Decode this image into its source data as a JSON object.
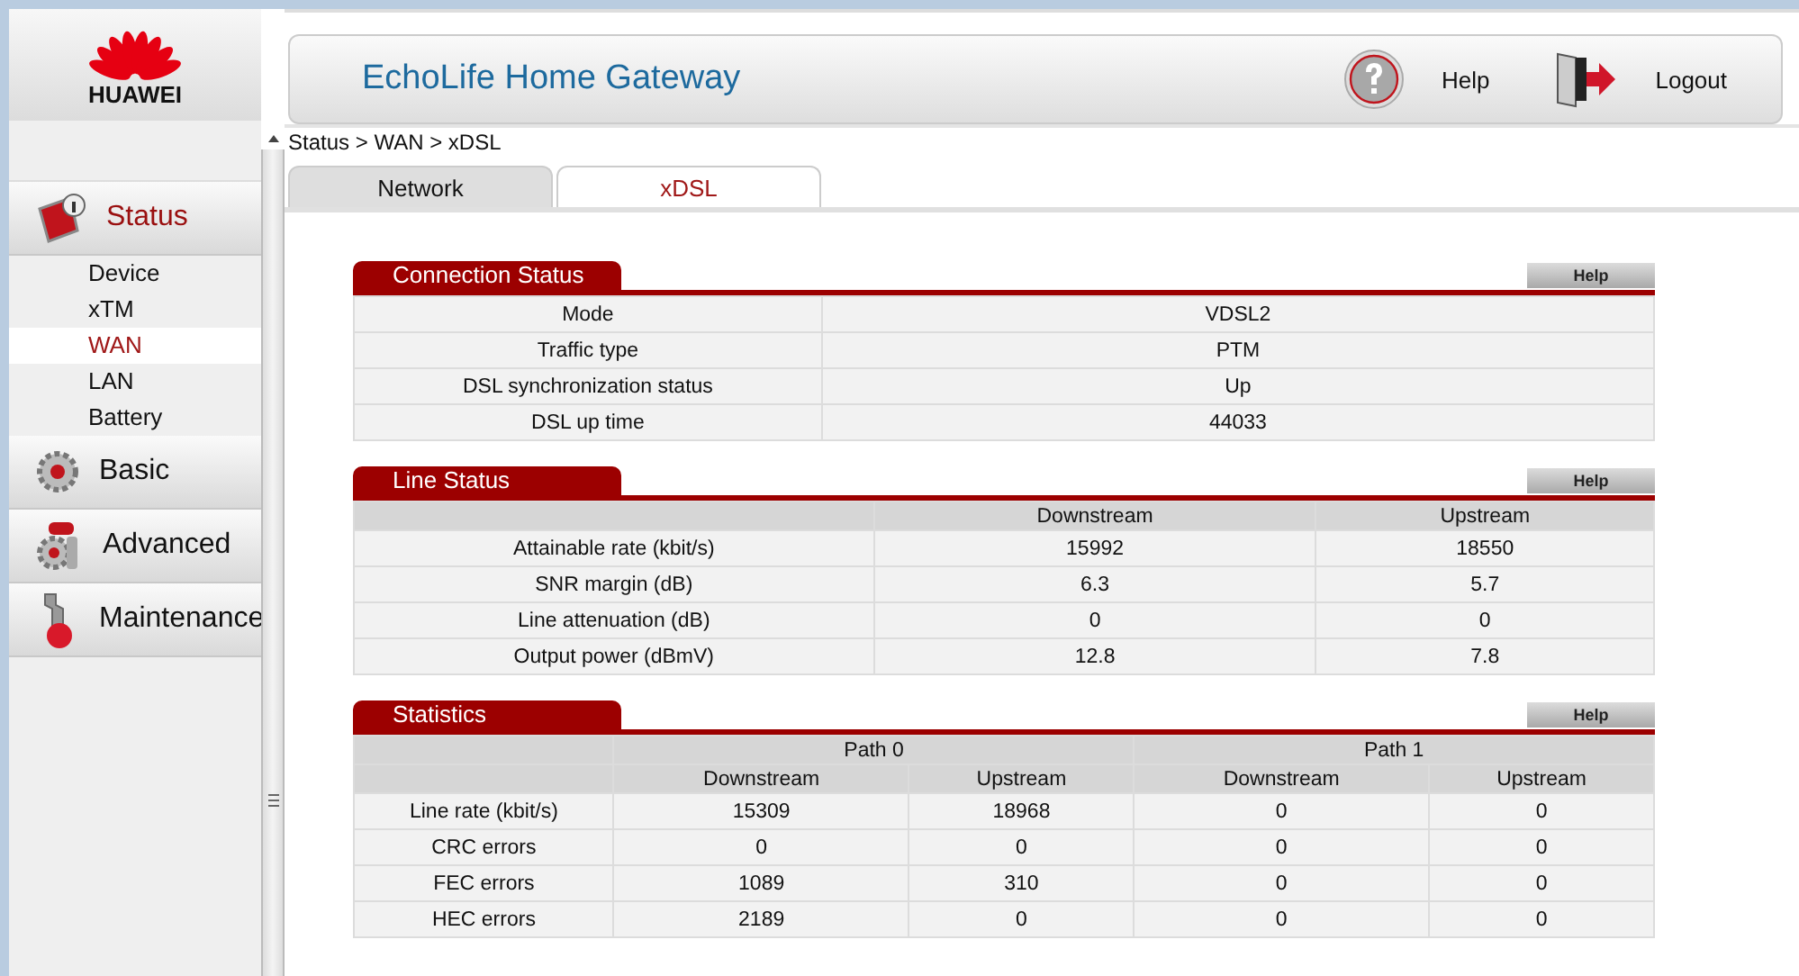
{
  "logo": {
    "text": "HUAWEI"
  },
  "header": {
    "title": "EchoLife Home Gateway",
    "help": "Help",
    "logout": "Logout"
  },
  "breadcrumb": "Status > WAN > xDSL",
  "tabs": [
    {
      "label": "Network",
      "selected": false
    },
    {
      "label": "xDSL",
      "selected": true
    }
  ],
  "sidebar": {
    "menus": [
      {
        "label": "Status",
        "selected": true,
        "children": [
          {
            "label": "Device",
            "selected": false
          },
          {
            "label": "xTM",
            "selected": false
          },
          {
            "label": "WAN",
            "selected": true
          },
          {
            "label": "LAN",
            "selected": false
          },
          {
            "label": "Battery",
            "selected": false
          }
        ]
      },
      {
        "label": "Basic",
        "selected": false
      },
      {
        "label": "Advanced",
        "selected": false
      },
      {
        "label": "Maintenance",
        "selected": false
      }
    ]
  },
  "connection_status": {
    "title": "Connection Status",
    "help": "Help",
    "rows": [
      {
        "label": "Mode",
        "value": "VDSL2"
      },
      {
        "label": "Traffic type",
        "value": "PTM"
      },
      {
        "label": "DSL synchronization status",
        "value": "Up"
      },
      {
        "label": "DSL up time",
        "value": "44033"
      }
    ]
  },
  "line_status": {
    "title": "Line Status",
    "help": "Help",
    "columns": [
      "Downstream",
      "Upstream"
    ],
    "rows": [
      {
        "label": "Attainable rate (kbit/s)",
        "values": [
          "15992",
          "18550"
        ]
      },
      {
        "label": "SNR margin (dB)",
        "values": [
          "6.3",
          "5.7"
        ]
      },
      {
        "label": "Line attenuation (dB)",
        "values": [
          "0",
          "0"
        ]
      },
      {
        "label": "Output power (dBmV)",
        "values": [
          "12.8",
          "7.8"
        ]
      }
    ]
  },
  "statistics": {
    "title": "Statistics",
    "help": "Help",
    "groups": [
      "Path 0",
      "Path 1"
    ],
    "columns": [
      "Downstream",
      "Upstream",
      "Downstream",
      "Upstream"
    ],
    "rows": [
      {
        "label": "Line rate (kbit/s)",
        "values": [
          "15309",
          "18968",
          "0",
          "0"
        ]
      },
      {
        "label": "CRC errors",
        "values": [
          "0",
          "0",
          "0",
          "0"
        ]
      },
      {
        "label": "FEC errors",
        "values": [
          "1089",
          "310",
          "0",
          "0"
        ]
      },
      {
        "label": "HEC errors",
        "values": [
          "2189",
          "0",
          "0",
          "0"
        ]
      }
    ]
  }
}
